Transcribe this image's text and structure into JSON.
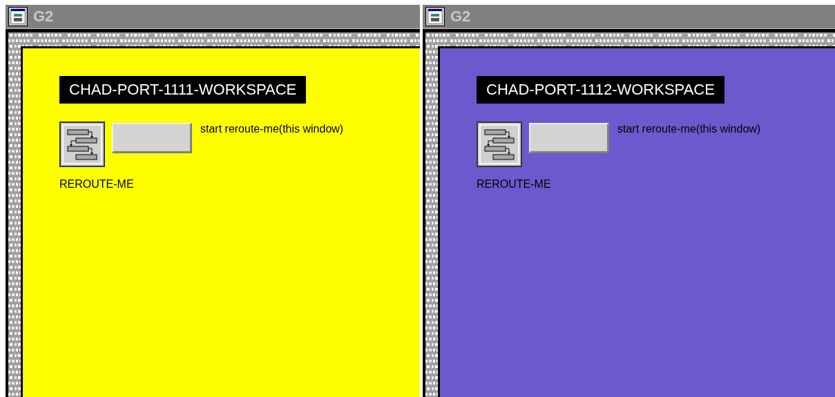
{
  "windows": [
    {
      "title": "G2",
      "color": "#ffff00",
      "workspace_title": "CHAD-PORT-1111-WORKSPACE",
      "procedure_label": "REROUTE-ME",
      "caption": "start reroute-me(this window)"
    },
    {
      "title": "G2",
      "color": "#6a5acd",
      "workspace_title": "CHAD-PORT-1112-WORKSPACE",
      "procedure_label": "REROUTE-ME",
      "caption": "start reroute-me(this window)"
    }
  ]
}
